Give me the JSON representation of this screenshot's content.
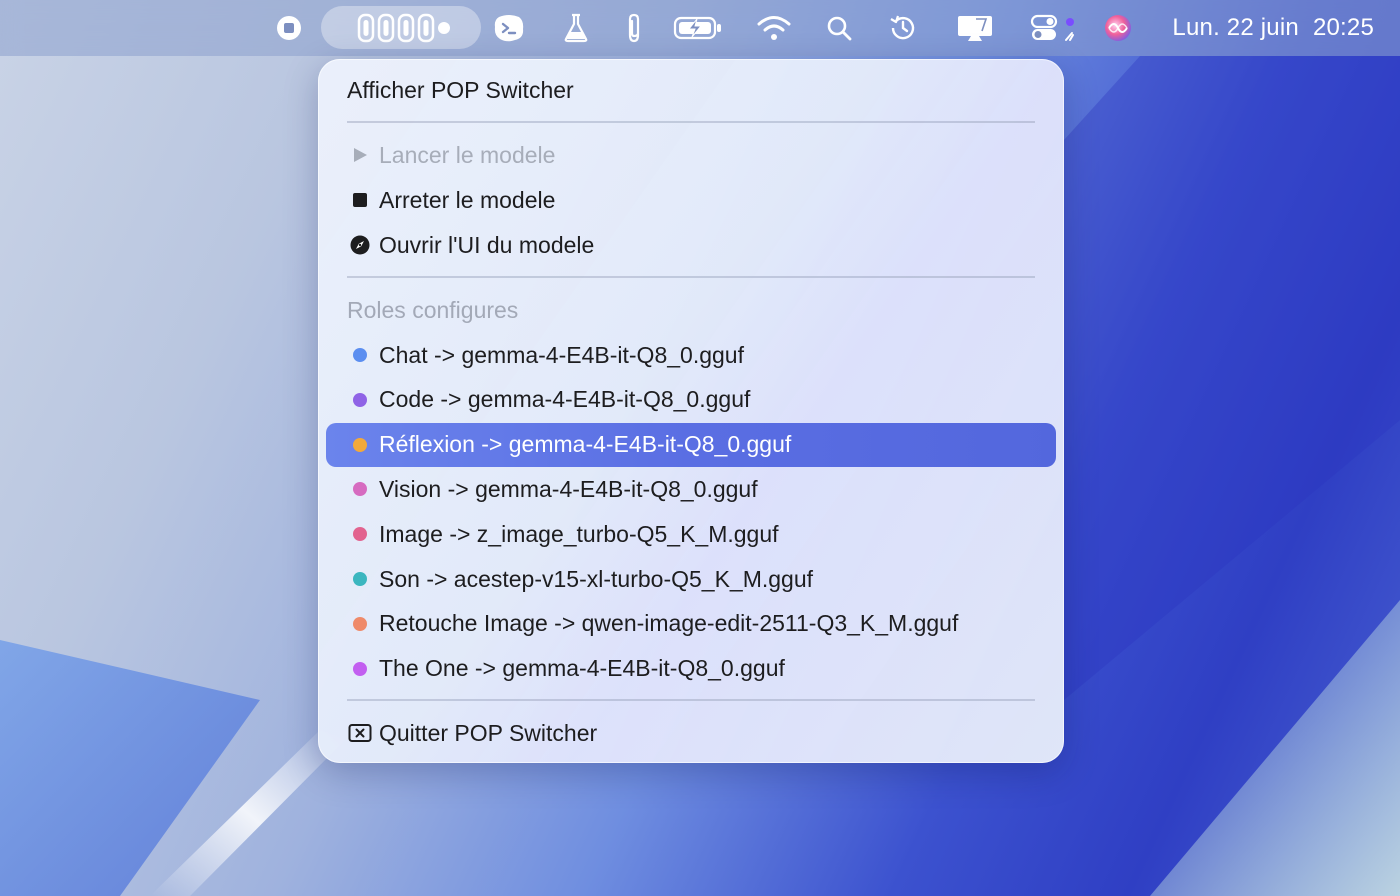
{
  "menubar": {
    "date": "Lun. 22 juin",
    "time": "20:25",
    "icons": [
      "stop-icon",
      "app-switcher-icon",
      "terminal-icon",
      "flask-icon",
      "paperclip-icon",
      "battery-charging-icon",
      "wifi-icon",
      "search-icon",
      "history-icon",
      "display-icon",
      "control-center-icon",
      "siri-icon"
    ]
  },
  "menu": {
    "show_app": "Afficher POP Switcher",
    "start_model": "Lancer le modele",
    "stop_model": "Arreter le modele",
    "open_ui": "Ouvrir l'UI du modele",
    "roles_header": "Roles configures",
    "roles": [
      {
        "label": "Chat -> gemma-4-E4B-it-Q8_0.gguf",
        "color": "#5b8ef0"
      },
      {
        "label": "Code -> gemma-4-E4B-it-Q8_0.gguf",
        "color": "#8f63e6"
      },
      {
        "label": "Réflexion -> gemma-4-E4B-it-Q8_0.gguf",
        "color": "#f2a93b"
      },
      {
        "label": "Vision -> gemma-4-E4B-it-Q8_0.gguf",
        "color": "#d66bc0"
      },
      {
        "label": "Image -> z_image_turbo-Q5_K_M.gguf",
        "color": "#e2638f"
      },
      {
        "label": "Son -> acestep-v15-xl-turbo-Q5_K_M.gguf",
        "color": "#3bb6bf"
      },
      {
        "label": "Retouche Image -> qwen-image-edit-2511-Q3_K_M.gguf",
        "color": "#ef8a6a"
      },
      {
        "label": "The One -> gemma-4-E4B-it-Q8_0.gguf",
        "color": "#c25ff0"
      }
    ],
    "selected_role": "Réflexion -> gemma-4-E4B-it-Q8_0.gguf",
    "quit": "Quitter POP Switcher"
  },
  "colors": {
    "selection": "#5a6ee3",
    "menubar_text": "#ffffff"
  }
}
